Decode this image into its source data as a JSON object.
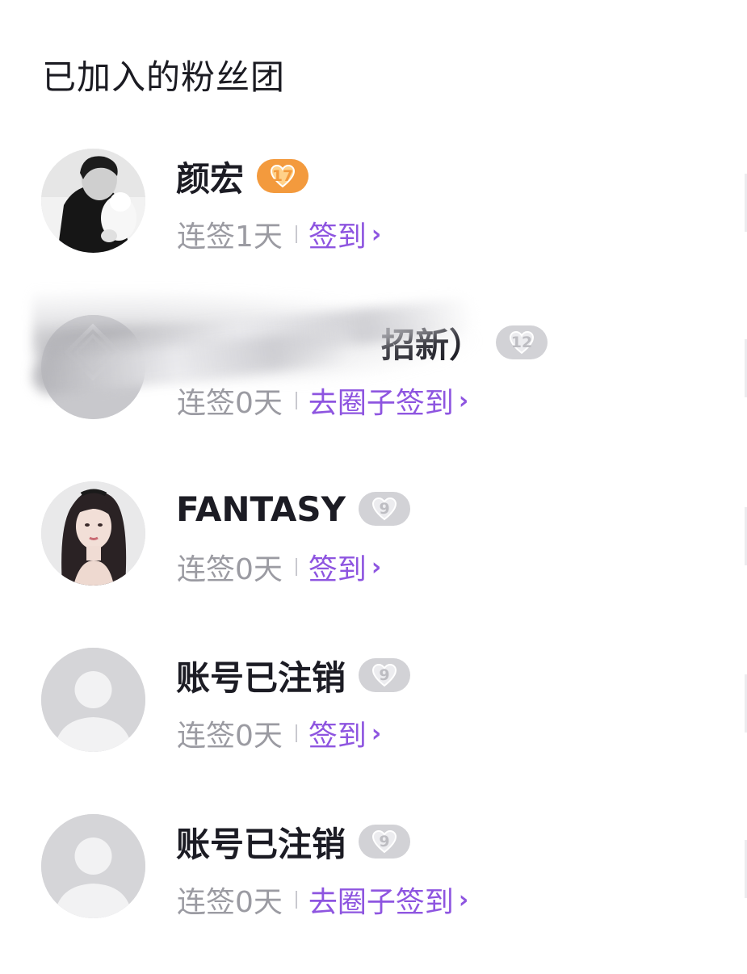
{
  "header": {
    "title": "已加入的粉丝团"
  },
  "fan_clubs": [
    {
      "name": "颜宏",
      "level": "17",
      "level_style": "gold",
      "streak": "连签1天",
      "action": "签到",
      "avatar": "photo-man-with-cat"
    },
    {
      "name": "招新）",
      "level": "12",
      "level_style": "grey",
      "streak": "连签0天",
      "action": "去圈子签到",
      "avatar": "blurred-logo",
      "obscured": true
    },
    {
      "name": "FANTASY",
      "level": "9",
      "level_style": "grey",
      "streak": "连签0天",
      "action": "签到",
      "avatar": "photo-woman"
    },
    {
      "name": "账号已注销",
      "level": "9",
      "level_style": "grey",
      "streak": "连签0天",
      "action": "签到",
      "avatar": "default-user"
    },
    {
      "name": "账号已注销",
      "level": "9",
      "level_style": "grey",
      "streak": "连签0天",
      "action": "去圈子签到",
      "avatar": "default-user"
    }
  ],
  "icons": {
    "chevron": "chevron-right-icon",
    "badge_heart": "heart-icon"
  },
  "colors": {
    "accent_purple": "#8e55e0",
    "badge_gold": "#f39a3d",
    "badge_grey": "#d2d2d6",
    "muted_text": "#9b9ba2"
  }
}
